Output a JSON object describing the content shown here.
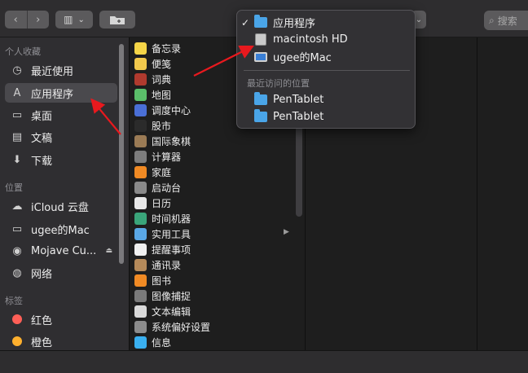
{
  "toolbar": {
    "back_glyph": "‹",
    "forward_glyph": "›",
    "view_glyph": "▥",
    "view_chevron": "⌄",
    "search_glyph": "⌕",
    "search_placeholder": "搜索"
  },
  "sidebar": {
    "favorites_header": "个人收藏",
    "favorites": [
      {
        "label": "最近使用",
        "icon": "clock-icon",
        "glyph": "◷"
      },
      {
        "label": "应用程序",
        "icon": "applications-icon",
        "glyph": "A",
        "selected": true
      },
      {
        "label": "桌面",
        "icon": "desktop-icon",
        "glyph": "▭"
      },
      {
        "label": "文稿",
        "icon": "documents-icon",
        "glyph": "▤"
      },
      {
        "label": "下载",
        "icon": "downloads-icon",
        "glyph": "⬇"
      }
    ],
    "locations_header": "位置",
    "locations": [
      {
        "label": "iCloud 云盘",
        "icon": "cloud-icon",
        "glyph": "☁"
      },
      {
        "label": "ugee的Mac",
        "icon": "computer-icon",
        "glyph": "▭"
      },
      {
        "label": "Mojave Cu...",
        "icon": "disc-icon",
        "glyph": "◉",
        "eject": "⏏"
      },
      {
        "label": "网络",
        "icon": "network-icon",
        "glyph": "◍"
      }
    ],
    "tags_header": "标签",
    "tags": [
      {
        "label": "红色",
        "color": "#ff5f57"
      },
      {
        "label": "橙色",
        "color": "#ffb02e"
      }
    ]
  },
  "applications": [
    {
      "label": "备忘录",
      "color": "#f5d547"
    },
    {
      "label": "便笺",
      "color": "#f2c94c"
    },
    {
      "label": "词典",
      "color": "#b03a2e"
    },
    {
      "label": "地图",
      "color": "#5bbf6a"
    },
    {
      "label": "调度中心",
      "color": "#4a6fd6"
    },
    {
      "label": "股市",
      "color": "#2b2b2b"
    },
    {
      "label": "国际象棋",
      "color": "#9b7b55"
    },
    {
      "label": "计算器",
      "color": "#7d7d7d"
    },
    {
      "label": "家庭",
      "color": "#f08a24"
    },
    {
      "label": "启动台",
      "color": "#8a8a8a"
    },
    {
      "label": "日历",
      "color": "#e8e8e8"
    },
    {
      "label": "时间机器",
      "color": "#3aa57a"
    },
    {
      "label": "实用工具",
      "color": "#5aa8e6"
    },
    {
      "label": "提醒事项",
      "color": "#f0f0f0"
    },
    {
      "label": "通讯录",
      "color": "#b58a5a"
    },
    {
      "label": "图书",
      "color": "#f08a24"
    },
    {
      "label": "图像捕捉",
      "color": "#7a7a7a"
    },
    {
      "label": "文本编辑",
      "color": "#d9d9d9"
    },
    {
      "label": "系统偏好设置",
      "color": "#8c8c8c"
    },
    {
      "label": "信息",
      "color": "#3ab0f0"
    }
  ],
  "column_arrow": "▶",
  "path_menu": {
    "check": "✓",
    "items": [
      {
        "label": "应用程序",
        "icon": "applications-folder-icon",
        "checked": true
      },
      {
        "label": "macintosh HD",
        "icon": "hard-drive-icon"
      },
      {
        "label": "ugee的Mac",
        "icon": "imac-icon"
      }
    ],
    "recent_header": "最近访问的位置",
    "recent": [
      {
        "label": "PenTablet",
        "icon": "folder-icon"
      },
      {
        "label": "PenTablet",
        "icon": "folder-icon"
      }
    ]
  },
  "annotation_color": "#e8191e"
}
